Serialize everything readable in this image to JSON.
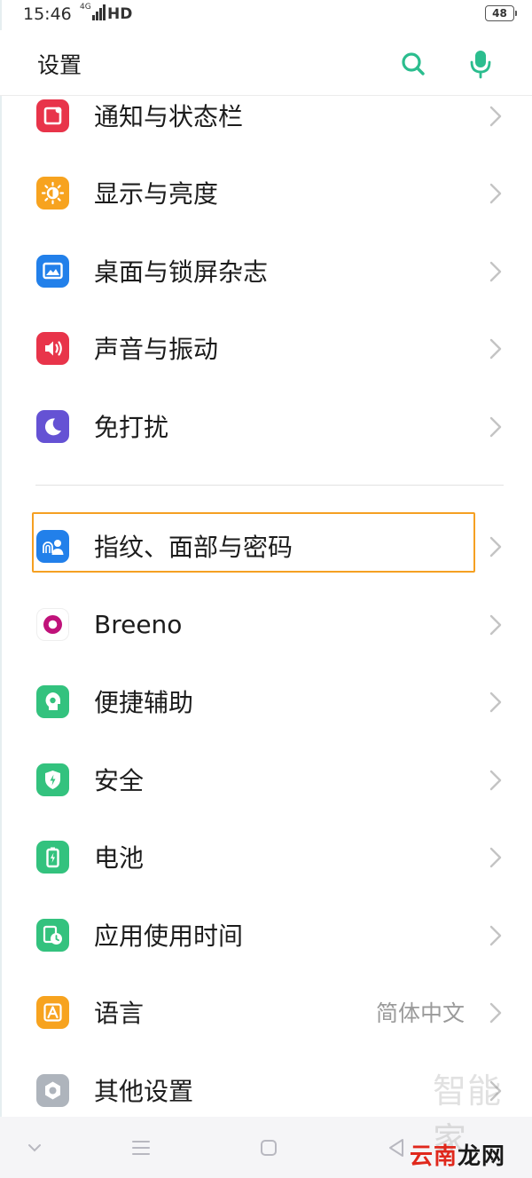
{
  "status_bar": {
    "time": "15:46",
    "network": "4G",
    "hd": "HD",
    "battery": "48"
  },
  "header": {
    "title": "设置",
    "search_icon": "search-icon",
    "mic_icon": "microphone-icon",
    "accent": "#2bbd8e"
  },
  "items": [
    {
      "label": "通知与状态栏",
      "icon": "notification-icon",
      "color": "#e8344a"
    },
    {
      "label": "显示与亮度",
      "icon": "brightness-icon",
      "color": "#f7a31f"
    },
    {
      "label": "桌面与锁屏杂志",
      "icon": "wallpaper-icon",
      "color": "#2280ea"
    },
    {
      "label": "声音与振动",
      "icon": "speaker-icon",
      "color": "#e8344a"
    },
    {
      "label": "免打扰",
      "icon": "moon-icon",
      "color": "#6552d4"
    },
    {
      "label": "指纹、面部与密码",
      "icon": "fingerprint-face-icon",
      "color": "#2280ea"
    },
    {
      "label": "Breeno",
      "icon": "breeno-icon",
      "color": "#c0127a"
    },
    {
      "label": "便捷辅助",
      "icon": "assist-icon",
      "color": "#33c27e"
    },
    {
      "label": "安全",
      "icon": "shield-icon",
      "color": "#33c27e"
    },
    {
      "label": "电池",
      "icon": "battery-icon",
      "color": "#33c27e"
    },
    {
      "label": "应用使用时间",
      "icon": "app-time-icon",
      "color": "#33c27e"
    },
    {
      "label": "语言",
      "icon": "language-icon",
      "color": "#f7a31f",
      "value": "简体中文"
    },
    {
      "label": "其他设置",
      "icon": "settings-icon",
      "color": "#aeb4bc"
    }
  ],
  "highlight_color": "#f5a022",
  "watermark": {
    "faint": "智能家",
    "part1": "云南",
    "part2": "龙网"
  }
}
